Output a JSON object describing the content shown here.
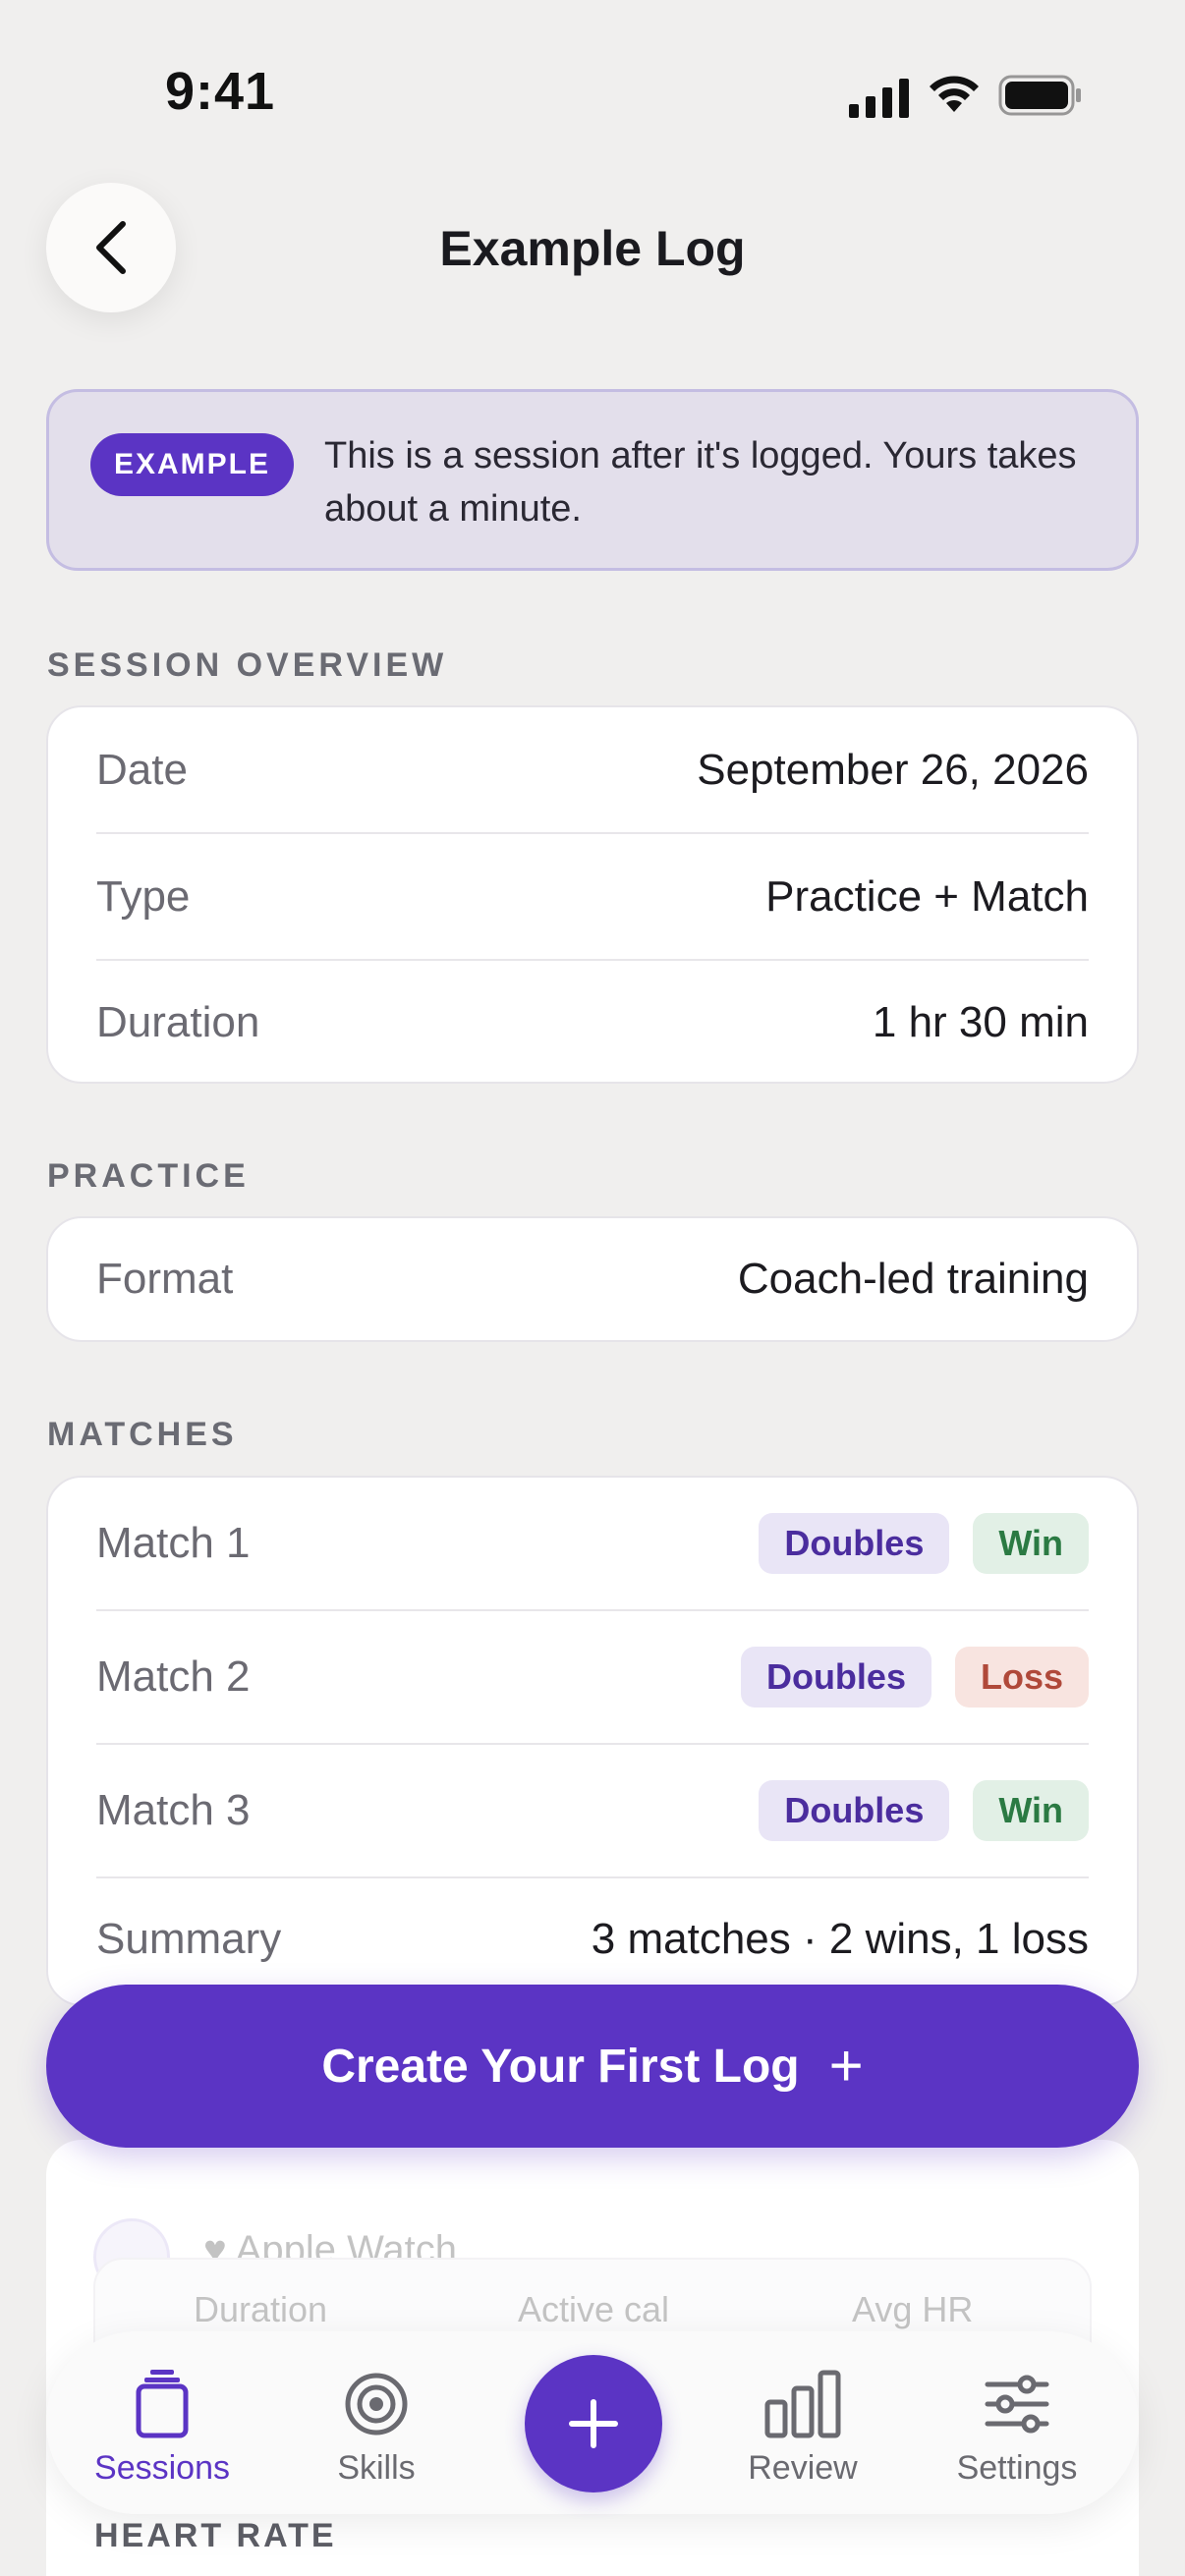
{
  "status_bar": {
    "time": "9:41"
  },
  "header": {
    "title": "Example Log"
  },
  "banner": {
    "badge": "EXAMPLE",
    "text": "This is a session after it's logged. Yours takes about a minute."
  },
  "session_overview": {
    "section_label": "SESSION OVERVIEW",
    "rows": [
      {
        "label": "Date",
        "value": "September 26, 2026"
      },
      {
        "label": "Type",
        "value": "Practice + Match"
      },
      {
        "label": "Duration",
        "value": "1 hr 30 min"
      }
    ]
  },
  "practice": {
    "section_label": "PRACTICE",
    "rows": [
      {
        "label": "Format",
        "value": "Coach-led training"
      }
    ]
  },
  "matches": {
    "section_label": "MATCHES",
    "rows": [
      {
        "label": "Match 1",
        "format": "Doubles",
        "result": "Win"
      },
      {
        "label": "Match 2",
        "format": "Doubles",
        "result": "Loss"
      },
      {
        "label": "Match 3",
        "format": "Doubles",
        "result": "Win"
      }
    ],
    "summary": {
      "label": "Summary",
      "value": "3 matches · 2 wins, 1 loss"
    }
  },
  "cta": {
    "label": "Create Your First Log",
    "icon": "plus-icon"
  },
  "faded_section": {
    "source_label": "Apple Watch",
    "stats": [
      {
        "label": "Duration"
      },
      {
        "label": "Active cal"
      },
      {
        "label": "Avg HR"
      }
    ],
    "heart_rate_label": "HEART RATE"
  },
  "tab_bar": {
    "tabs": [
      {
        "label": "Sessions",
        "icon": "sessions-icon",
        "active": true
      },
      {
        "label": "Skills",
        "icon": "target-icon"
      },
      {
        "label": "Review",
        "icon": "bar-chart-icon"
      },
      {
        "label": "Settings",
        "icon": "sliders-icon"
      }
    ],
    "add_icon": "plus-icon"
  },
  "colors": {
    "accent": "#5b34c4",
    "background": "#f0efee",
    "win": "#2b7a43",
    "loss": "#b0493a"
  }
}
